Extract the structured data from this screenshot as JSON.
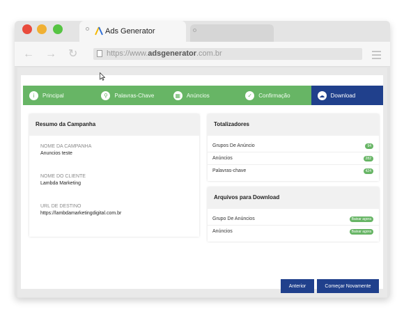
{
  "browser": {
    "tab_title": "Ads Generator",
    "url_prefix": "https://www.",
    "url_domain": "adsgenerator",
    "url_suffix": ".com.br"
  },
  "icons": {
    "back": "arrow-left-icon",
    "forward": "arrow-right-icon",
    "reload": "reload-icon",
    "menu": "hamburger-menu-icon",
    "page": "document-icon"
  },
  "colors": {
    "accent_green": "#67b565",
    "accent_blue": "#20408c"
  },
  "steps": [
    {
      "label": "Principal",
      "icon": "info-icon"
    },
    {
      "label": "Palavras-Chave",
      "icon": "search-icon"
    },
    {
      "label": "Anúncios",
      "icon": "grid-icon"
    },
    {
      "label": "Confirmação",
      "icon": "check-circle-icon"
    },
    {
      "label": "Download",
      "icon": "cloud-download-icon"
    }
  ],
  "summary": {
    "title": "Resumo da Campanha",
    "campaign_label": "Nome da Campanha",
    "campaign_value": "Anuncios teste",
    "client_label": "Nome do Cliente",
    "client_value": "Lambda Marketing",
    "url_label": "URL de Destino",
    "url_value": "https://lambdamarketingdigital.com.br"
  },
  "totals": {
    "title": "Totalizadores",
    "rows": [
      {
        "label": "Grupos De Anúncio",
        "count": "94"
      },
      {
        "label": "Anúncios",
        "count": "282"
      },
      {
        "label": "Palavras-chave",
        "count": "424"
      }
    ]
  },
  "downloads": {
    "title": "Arquivos para Download",
    "rows": [
      {
        "label": "Grupo De Anúncios",
        "action": "Baixar agora"
      },
      {
        "label": "Anúncios",
        "action": "Baixar agora"
      }
    ]
  },
  "actions": {
    "previous": "Anterior",
    "restart": "Começar Novamente"
  }
}
